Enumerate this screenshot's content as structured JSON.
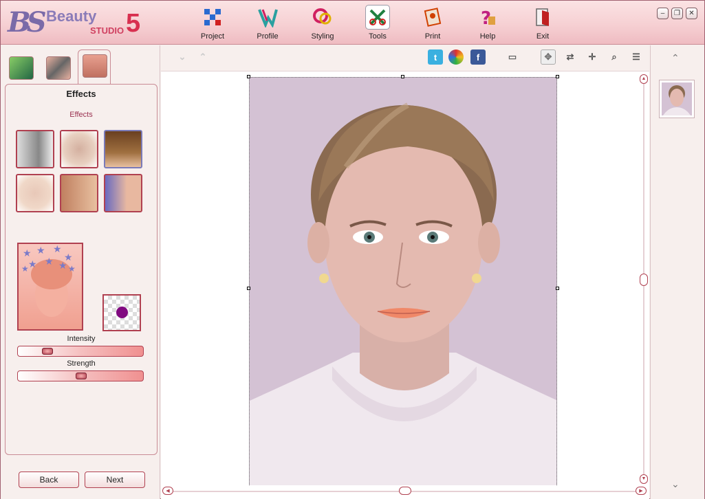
{
  "app": {
    "logo_mark": "BS",
    "logo_beauty": "Beauty",
    "logo_studio": "STUDIO",
    "logo_version": "5"
  },
  "nav": [
    {
      "label": "Project",
      "icon": "project-icon",
      "color": "#2a6ad0"
    },
    {
      "label": "Profile",
      "icon": "profile-icon",
      "color": "#2aa0a0"
    },
    {
      "label": "Styling",
      "icon": "styling-icon",
      "color": "#d02060"
    },
    {
      "label": "Tools",
      "icon": "tools-icon",
      "color": "#208040",
      "active": true
    },
    {
      "label": "Print",
      "icon": "print-icon",
      "color": "#d04000"
    },
    {
      "label": "Help",
      "icon": "help-icon",
      "color": "#c02080"
    },
    {
      "label": "Exit",
      "icon": "exit-icon",
      "color": "#c02020"
    }
  ],
  "window_controls": [
    "minimize",
    "restore",
    "close"
  ],
  "left_panel": {
    "title": "Effects",
    "subtitle": "Effects",
    "intensity_label": "Intensity",
    "intensity_value": 0.2,
    "strength_label": "Strength",
    "strength_value": 0.5,
    "swatch_color": "#800a80",
    "back_label": "Back",
    "next_label": "Next"
  },
  "toolbar": {
    "twitter": "t",
    "facebook": "f"
  },
  "colors": {
    "accent": "#b04050",
    "header_bg": "#f6d0d3",
    "photo_bg": "#d4c2d4"
  }
}
